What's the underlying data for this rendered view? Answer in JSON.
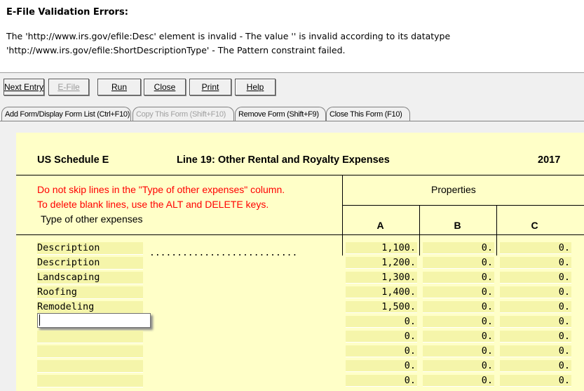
{
  "errors": {
    "title": "E-File Validation Errors:",
    "line1": "The 'http://www.irs.gov/efile:Desc' element is invalid - The value '' is invalid according to its datatype",
    "line2": "'http://www.irs.gov/efile:ShortDescriptionType' - The Pattern constraint failed."
  },
  "toolbar": {
    "next_entry": "Next Entry",
    "efile": "E-File",
    "run": "Run",
    "close": "Close",
    "print": "Print",
    "help": "Help"
  },
  "tabs": {
    "add_form": "Add Form/Display Form List (Ctrl+F10)",
    "copy_form": "Copy This Form (Shift+F10)",
    "remove_form": "Remove Form (Shift+F9)",
    "close_form": "Close This Form (F10)"
  },
  "form": {
    "schedule": "US Schedule E",
    "line_title": "Line 19:  Other Rental and Royalty Expenses",
    "year": "2017",
    "warning1": "Do not skip lines in the  \"Type of other expenses\"  column.",
    "warning2": "To delete blank lines,  use the ALT and DELETE keys.",
    "type_header": "Type of other expenses",
    "properties_header": "Properties",
    "col_a": "A",
    "col_b": "B",
    "col_c": "C",
    "leader_dots": "...........................",
    "rows": [
      {
        "desc": "Description",
        "a": "1,100.",
        "b": "0.",
        "c": "0."
      },
      {
        "desc": "Description",
        "a": "1,200.",
        "b": "0.",
        "c": "0."
      },
      {
        "desc": "Landscaping",
        "a": "1,300.",
        "b": "0.",
        "c": "0."
      },
      {
        "desc": "Roofing",
        "a": "1,400.",
        "b": "0.",
        "c": "0."
      },
      {
        "desc": "Remodeling",
        "a": "1,500.",
        "b": "0.",
        "c": "0."
      },
      {
        "desc": "",
        "a": "0.",
        "b": "0.",
        "c": "0."
      },
      {
        "desc": "",
        "a": "0.",
        "b": "0.",
        "c": "0."
      },
      {
        "desc": "",
        "a": "0.",
        "b": "0.",
        "c": "0."
      },
      {
        "desc": "",
        "a": "0.",
        "b": "0.",
        "c": "0."
      },
      {
        "desc": "",
        "a": "0.",
        "b": "0.",
        "c": "0."
      }
    ]
  }
}
